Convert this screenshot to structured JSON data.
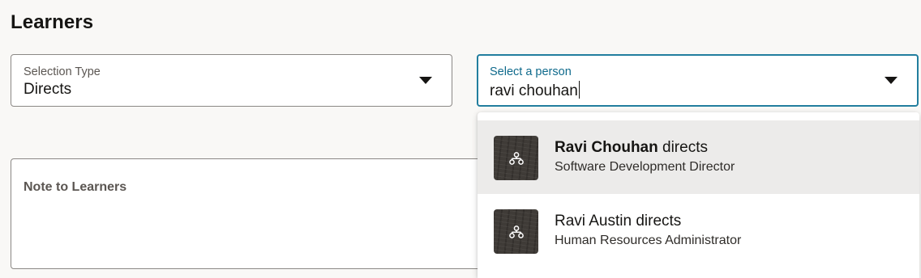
{
  "page": {
    "title": "Learners"
  },
  "selection_type": {
    "label": "Selection Type",
    "value": "Directs"
  },
  "person_select": {
    "label": "Select a person",
    "input_value": "ravi chouhan"
  },
  "note": {
    "label": "Note to Learners"
  },
  "dropdown": {
    "options": [
      {
        "name": "Ravi Chouhan",
        "suffix": " directs",
        "title": "Software Development Director",
        "highlighted": true,
        "icon": "hierarchy-icon"
      },
      {
        "name": "Ravi Austin",
        "suffix": " directs",
        "title": "Human Resources Administrator",
        "highlighted": false,
        "icon": "hierarchy-icon"
      }
    ]
  },
  "colors": {
    "focus_border": "#227e9e",
    "focus_label": "#0f6a8c",
    "highlight_bg": "#ecebea",
    "page_bg": "#f9f8f6"
  }
}
